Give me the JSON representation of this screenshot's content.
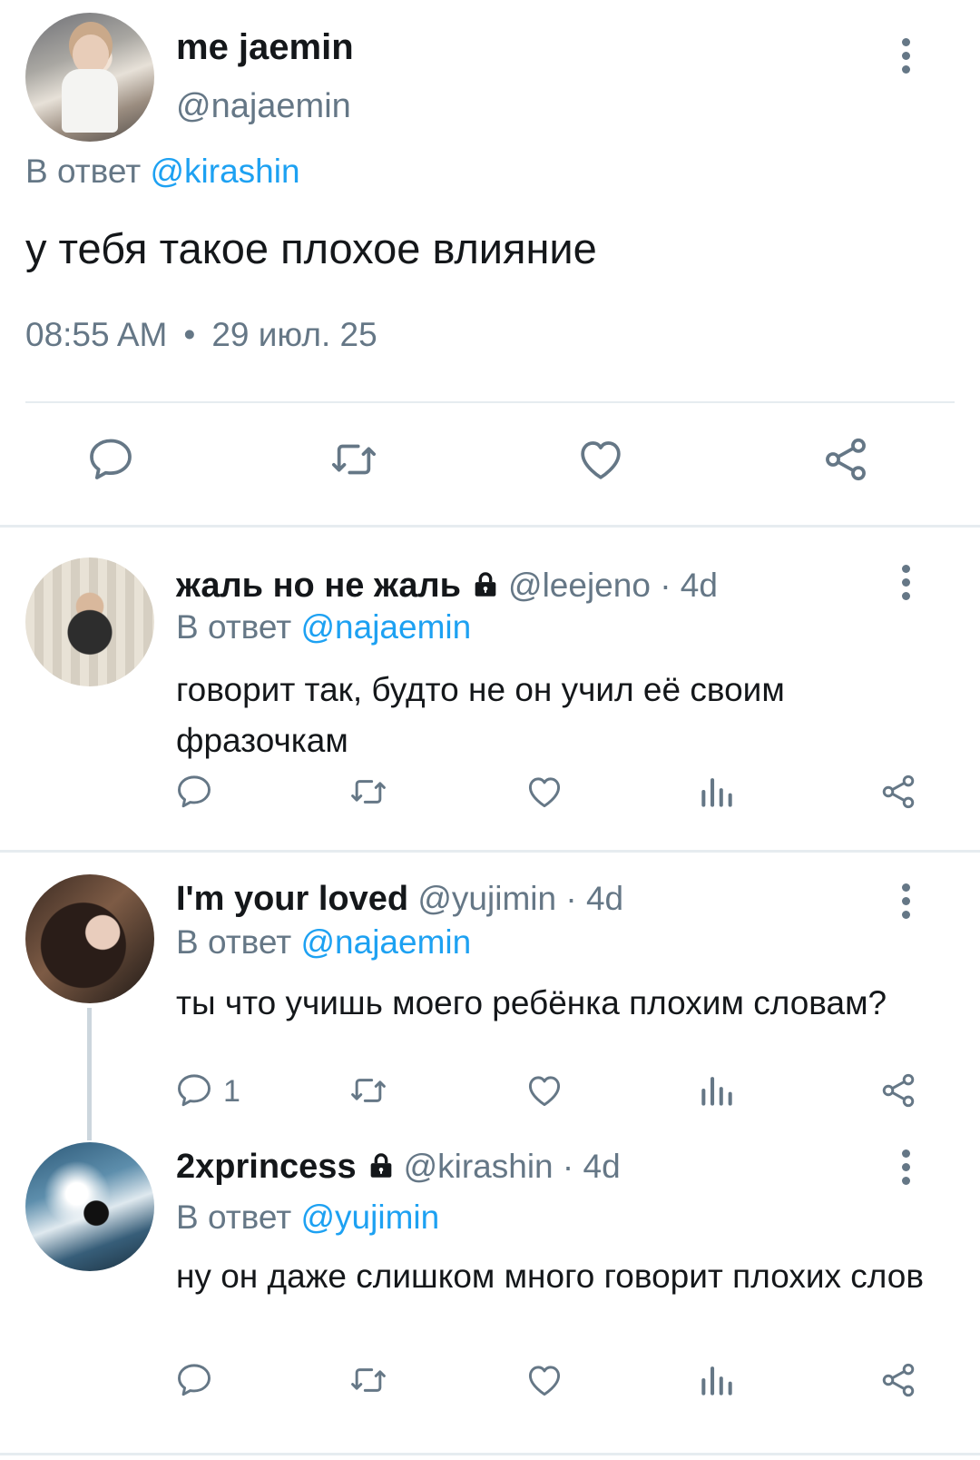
{
  "main_tweet": {
    "display_name": "me jaemin",
    "handle": "@najaemin",
    "reply_prefix": "В ответ",
    "reply_to": "@kirashin",
    "text": "у тебя такое плохое влияние",
    "time": "08:55 AM",
    "separator": "•",
    "date": "29 июл. 25",
    "actions": [
      "reply-icon",
      "retweet-icon",
      "heart-icon",
      "share-icon"
    ]
  },
  "replies": [
    {
      "display_name": "жаль но не жаль",
      "locked": true,
      "handle": "@leejeno",
      "age": "· 4d",
      "reply_prefix": "В ответ",
      "reply_to": "@najaemin",
      "text": "говорит так, будто не он учил её своим фразочкам",
      "reply_count": ""
    },
    {
      "display_name": "I'm your loved",
      "locked": false,
      "handle": "@yujimin",
      "age": "· 4d",
      "reply_prefix": "В ответ",
      "reply_to": "@najaemin",
      "text": "ты что учишь моего ребёнка плохим словам?",
      "reply_count": "1"
    },
    {
      "display_name": "2xprincess",
      "locked": true,
      "handle": "@kirashin",
      "age": "· 4d",
      "reply_prefix": "В ответ",
      "reply_to": "@yujimin",
      "text": "ну он даже слишком много говорит плохих слов",
      "reply_count": ""
    }
  ],
  "colors": {
    "link": "#1da1f2",
    "muted": "#657786",
    "text": "#14171a",
    "divider": "#e6ecf0"
  }
}
